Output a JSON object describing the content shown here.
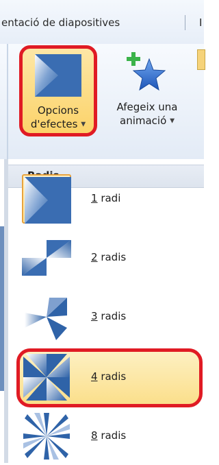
{
  "ribbon": {
    "tab_title": "entació de diapositives",
    "next_tab_fragment": "I",
    "effect_options_button": {
      "line1": "Opcions",
      "line2": "d'efectes",
      "icon": "effect-options-icon"
    },
    "add_animation_button": {
      "line1": "Afegeix una",
      "line2": "animació",
      "icon": "add-animation-star-icon"
    }
  },
  "menu": {
    "header": "Radis",
    "items": [
      {
        "key": "1",
        "label": " radi",
        "icon": "spoke-1-icon",
        "state": "selected"
      },
      {
        "key": "2",
        "label": " radis",
        "icon": "spoke-2-icon",
        "state": "normal"
      },
      {
        "key": "3",
        "label": " radis",
        "icon": "spoke-3-icon",
        "state": "normal"
      },
      {
        "key": "4",
        "label": " radis",
        "icon": "spoke-4-icon",
        "state": "hover"
      },
      {
        "key": "8",
        "label": " radis",
        "icon": "spoke-8-icon",
        "state": "normal"
      }
    ]
  },
  "colors": {
    "highlight_red": "#e01b24",
    "icon_blue": "#2f63a8",
    "selection_gold": "#fcd36a"
  }
}
